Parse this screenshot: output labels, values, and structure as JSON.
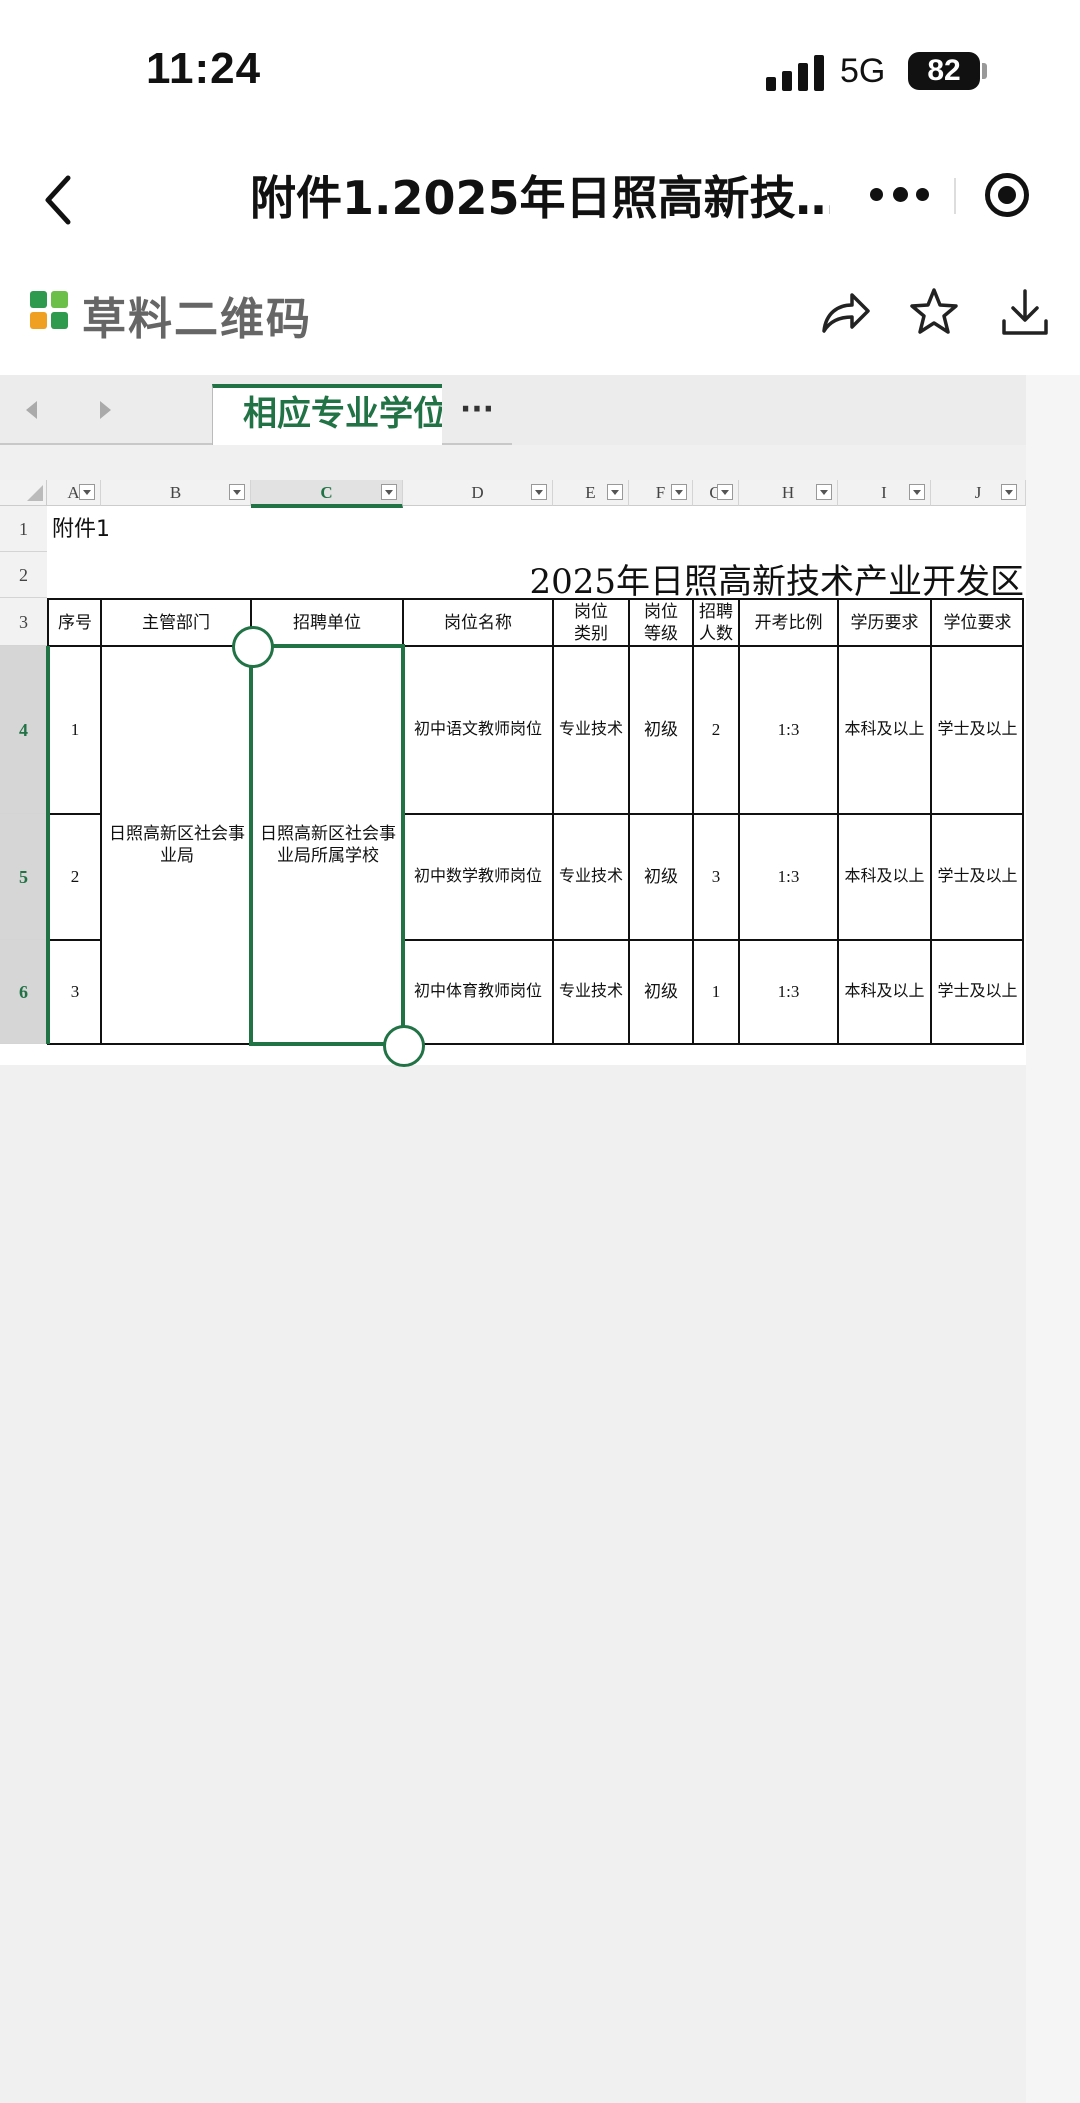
{
  "status_bar": {
    "time": "11:24",
    "network": "5G",
    "battery": "82"
  },
  "title_bar": {
    "title": "附件1.2025年日照高新技…"
  },
  "app_bar": {
    "brand": "草料二维码"
  },
  "sheet_tabs": {
    "active": "相应专业学位",
    "more": "···"
  },
  "spreadsheet": {
    "columns": [
      "A",
      "B",
      "C",
      "D",
      "E",
      "F",
      "G",
      "H",
      "I",
      "J"
    ],
    "selected_column": "C",
    "rows": [
      "1",
      "2",
      "3",
      "4",
      "5",
      "6"
    ],
    "selected_rows": [
      "4",
      "5",
      "6"
    ],
    "a1": "附件1",
    "title": "2025年日照高新技术产业开发区",
    "headers": {
      "seq": "序号",
      "dept": "主管部门",
      "unit": "招聘单位",
      "position": "岗位名称",
      "category_l1": "岗位",
      "category_l2": "类别",
      "level_l1": "岗位",
      "level_l2": "等级",
      "count_l1": "招聘",
      "count_l2": "人数",
      "ratio": "开考比例",
      "education": "学历要求",
      "degree": "学位要求"
    },
    "merged_dept": "日照高新区社会事业局",
    "merged_unit": "日照高新区社会事业局所属学校",
    "data_rows": [
      {
        "seq": "1",
        "position": "初中语文教师岗位",
        "category": "专业技术",
        "level": "初级",
        "count": "2",
        "ratio": "1:3",
        "education": "本科及以上",
        "degree": "学士及以上"
      },
      {
        "seq": "2",
        "position": "初中数学教师岗位",
        "category": "专业技术",
        "level": "初级",
        "count": "3",
        "ratio": "1:3",
        "education": "本科及以上",
        "degree": "学士及以上"
      },
      {
        "seq": "3",
        "position": "初中体育教师岗位",
        "category": "专业技术",
        "level": "初级",
        "count": "1",
        "ratio": "1:3",
        "education": "本科及以上",
        "degree": "学士及以上"
      }
    ]
  },
  "colors": {
    "accent": "#217346",
    "logo": [
      "#2e9a4e",
      "#6cc04a",
      "#f0a020",
      "#2e9a4e"
    ]
  },
  "icons": [
    "back-icon",
    "more-icon",
    "close-target-icon",
    "logo-icon",
    "share-icon",
    "star-icon",
    "download-icon",
    "prev-sheet-icon",
    "next-sheet-icon",
    "filter-icon"
  ]
}
